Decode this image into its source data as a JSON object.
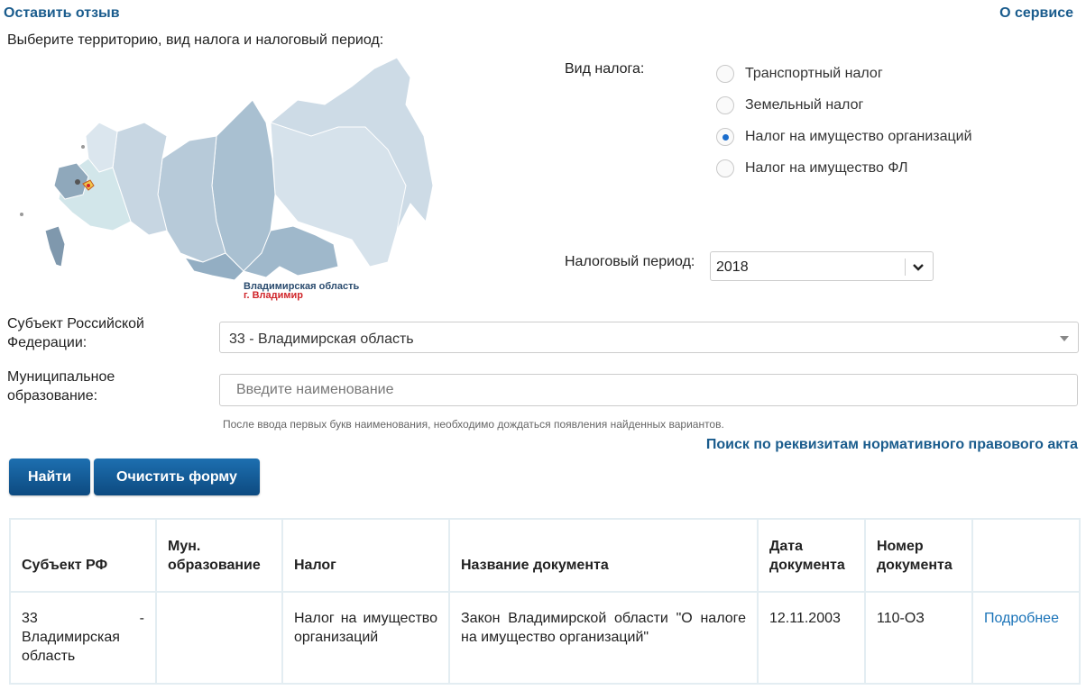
{
  "header": {
    "feedback_link": "Оставить отзыв",
    "about_link": "О сервисе",
    "intro": "Выберите территорию, вид налога и налоговый период:"
  },
  "map": {
    "region_caption": "Владимирская область",
    "city_caption": "г. Владимир",
    "region_color": "#a9c0d1",
    "selected_color": "#f2c94c"
  },
  "tax_type": {
    "label": "Вид налога:",
    "options": [
      {
        "label": "Транспортный налог",
        "checked": false
      },
      {
        "label": "Земельный налог",
        "checked": false
      },
      {
        "label": "Налог на имущество организаций",
        "checked": true
      },
      {
        "label": "Налог на имущество ФЛ",
        "checked": false
      }
    ]
  },
  "period": {
    "label": "Налоговый период:",
    "value": "2018"
  },
  "form": {
    "subject_label_line1": "Субъект Российской",
    "subject_label_line2": "Федерации:",
    "subject_value": "33 - Владимирская область",
    "muni_label_line1": "Муниципальное",
    "muni_label_line2": "образование:",
    "muni_placeholder": "Введите наименование",
    "hint": "После ввода первых букв наименования, необходимо дождаться появления найденных вариантов.",
    "requisites_link": "Поиск по реквизитам нормативного правового акта",
    "find_button": "Найти",
    "clear_button": "Очистить форму"
  },
  "table": {
    "headers": {
      "subject": "Субъект РФ",
      "muni": "Мун. образование",
      "tax": "Налог",
      "doc_name": "Название документа",
      "doc_date": "Дата документа",
      "doc_number": "Номер документа"
    },
    "rows": [
      {
        "subject": "33 - Владимирская область",
        "muni": "",
        "tax": "Налог на имущество организаций",
        "doc_name": "Закон Владимирской области \"О налоге на имущество организаций\"",
        "doc_date": "12.11.2003",
        "doc_number": "110-ОЗ",
        "more": "Подробнее"
      }
    ]
  },
  "colors": {
    "link": "#1a5c8d",
    "button": "#135b97",
    "radio_dot": "#1a6dcc",
    "city_caption": "#d0252a"
  }
}
